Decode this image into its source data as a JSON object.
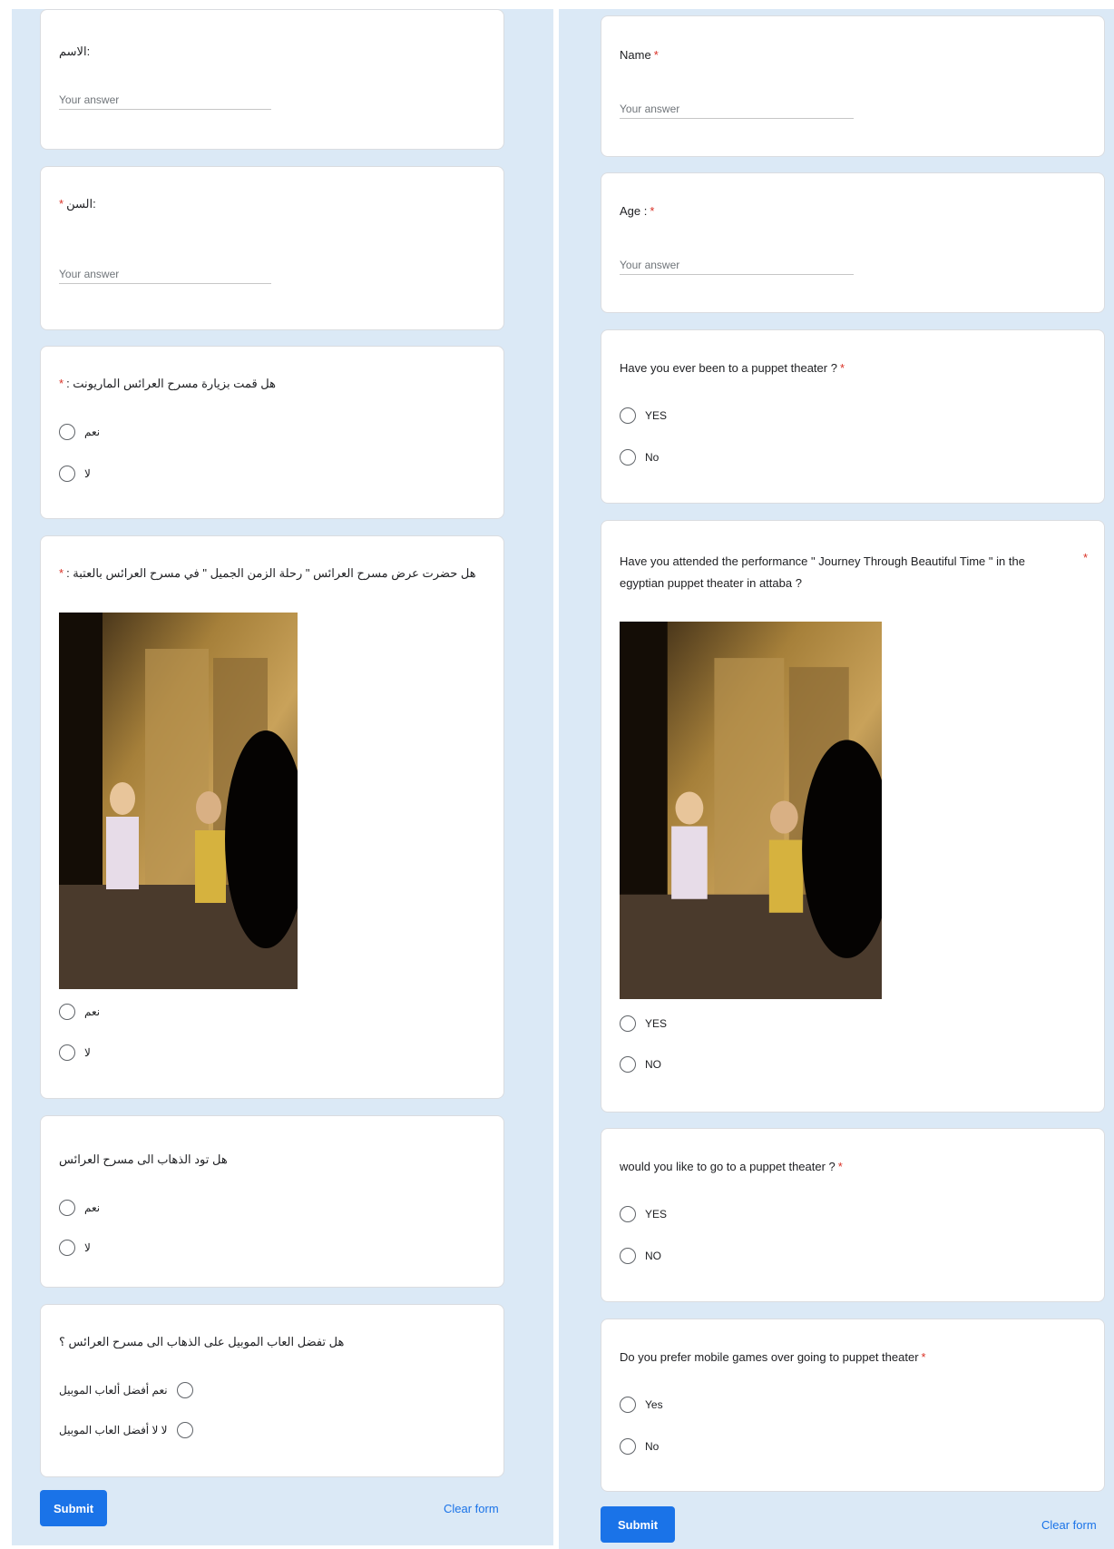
{
  "placeholder_text": "Your answer",
  "required_mark": "*",
  "accent_color": "#1a73e8",
  "background_color": "#dbe9f6",
  "arabic_form": {
    "q_name": ":الاسم",
    "q_age": ":السن",
    "q_visited": "هل قمت بزيارة مسرح العرائس الماريونت :",
    "q_visited_options": [
      "نعم",
      "لا"
    ],
    "q_attended": "هل حضرت عرض مسرح العرائس \" رحلة الزمن الجميل \" في مسرح العرائس بالعتبة :",
    "q_attended_options": [
      "نعم",
      "لا"
    ],
    "q_like": "هل تود الذهاب الى مسرح العرائس",
    "q_like_options": [
      "نعم",
      "لا"
    ],
    "q_prefer": "هل تفضل العاب الموبيل على الذهاب الى مسرح العرائس ؟",
    "q_prefer_options": [
      "نعم أفضل ألعاب الموبيل",
      "لا لا أفضل العاب الموبيل"
    ],
    "submit_label": "Submit",
    "clear_label": "Clear form"
  },
  "english_form": {
    "q_name": "Name",
    "q_age": "Age :",
    "q_visited": "Have you ever been to a puppet theater ?",
    "q_visited_options": [
      "YES",
      "No"
    ],
    "q_attended_line1": "Have you attended the performance \" Journey Through Beautiful Time \" in the",
    "q_attended_line2": "egyptian puppet theater  in attaba ?",
    "q_attended_options": [
      "YES",
      "NO"
    ],
    "q_like": "would you like to go to a puppet theater ?",
    "q_like_options": [
      "YES",
      "NO"
    ],
    "q_prefer": "Do you prefer mobile games over going to puppet theater",
    "q_prefer_options": [
      "Yes",
      "No"
    ],
    "submit_label": "Submit",
    "clear_label": "Clear form"
  }
}
